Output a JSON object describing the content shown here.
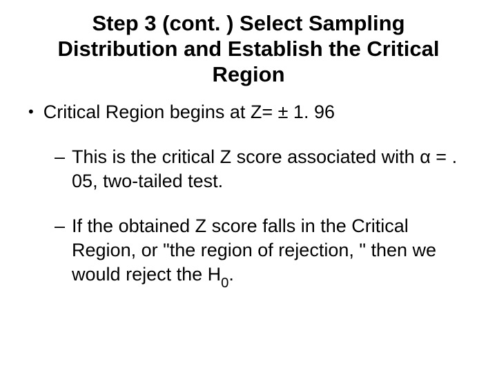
{
  "slide": {
    "title": "Step 3 (cont. ) Select Sampling Distribution and Establish the Critical Region",
    "bullet1": "Critical Region begins at Z= ± 1. 96",
    "sub1": "This is the critical Z score associated with  α = . 05, two-tailed test.",
    "sub2_pre": "If the obtained Z score falls in the Critical Region, or \"the region of rejection, \" then we would reject the H",
    "sub2_sub": "0",
    "sub2_post": "."
  }
}
